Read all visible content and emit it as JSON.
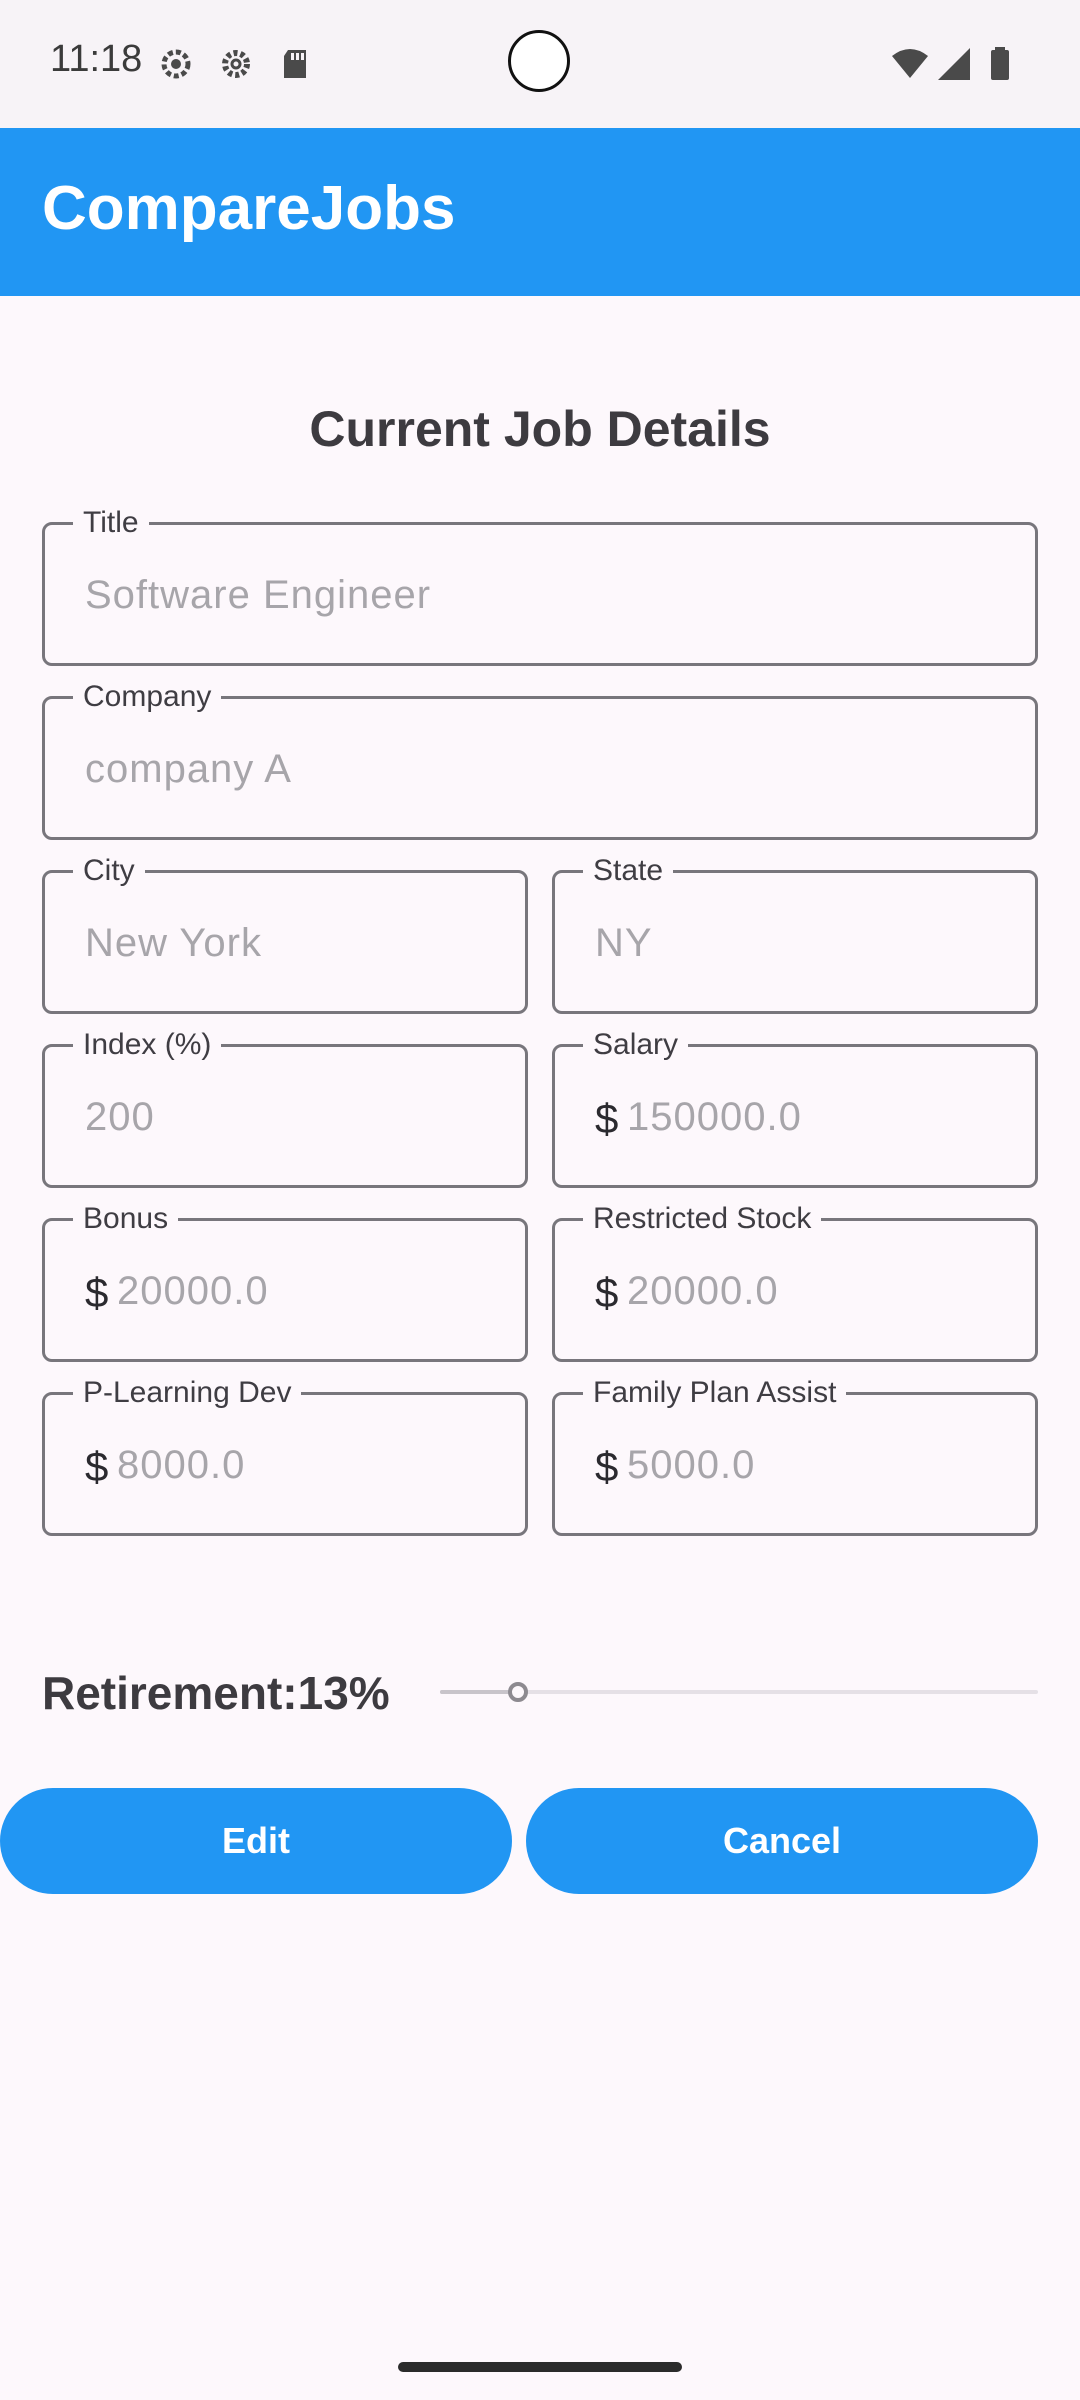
{
  "status_bar": {
    "time": "11:18",
    "icons": [
      "gear-badge-icon",
      "settings-gear-icon",
      "sd-card-icon",
      "wifi-icon",
      "cell-signal-icon",
      "battery-icon"
    ]
  },
  "app_bar": {
    "title": "CompareJobs",
    "color": "#2196f3"
  },
  "form": {
    "heading": "Current Job Details",
    "title": {
      "label": "Title",
      "value": "Software Engineer"
    },
    "company": {
      "label": "Company",
      "value": "company A"
    },
    "city": {
      "label": "City",
      "value": "New York"
    },
    "state": {
      "label": "State",
      "value": "NY"
    },
    "index": {
      "label": "Index (%)",
      "value": "200"
    },
    "salary": {
      "label": "Salary",
      "prefix": "$",
      "value": "150000.0"
    },
    "bonus": {
      "label": "Bonus",
      "prefix": "$",
      "value": "20000.0"
    },
    "restricted_stock": {
      "label": "Restricted Stock",
      "prefix": "$",
      "value": "20000.0"
    },
    "learning_dev": {
      "label": "P-Learning Dev",
      "prefix": "$",
      "value": "8000.0"
    },
    "family_plan": {
      "label": "Family Plan Assist",
      "prefix": "$",
      "value": "5000.0"
    }
  },
  "retirement": {
    "label": "Retirement:13%",
    "value_percent": 13
  },
  "actions": {
    "edit_label": "Edit",
    "cancel_label": "Cancel"
  }
}
